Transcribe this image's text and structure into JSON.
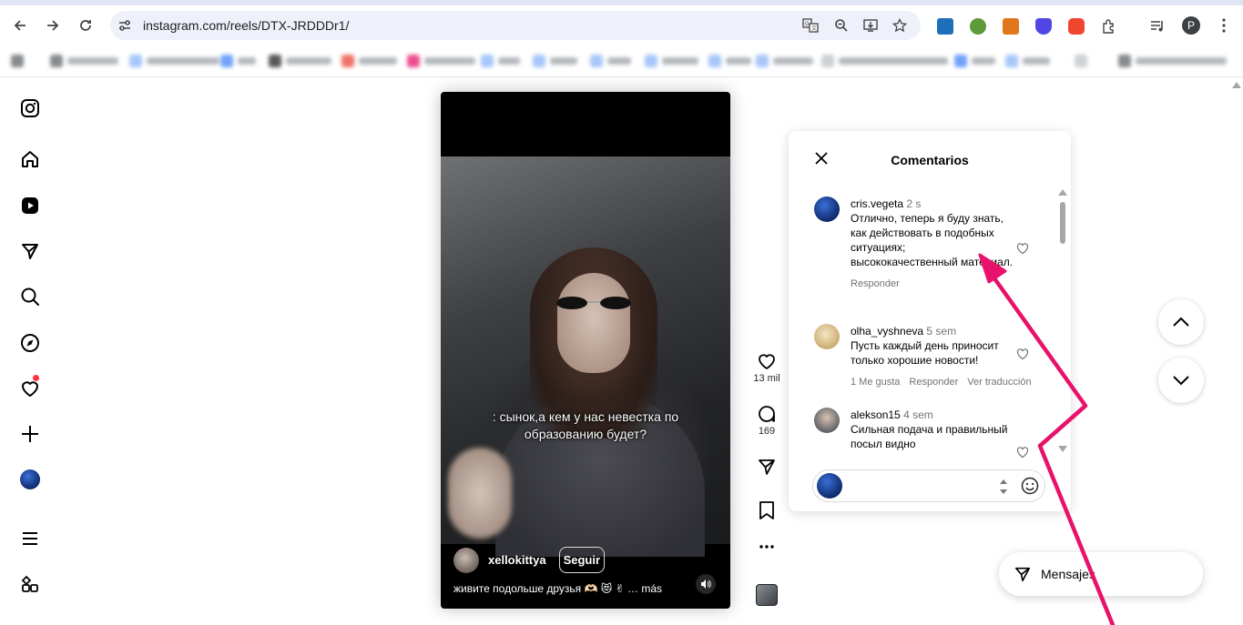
{
  "browser": {
    "url": "instagram.com/reels/DTX-JRDDDr1/",
    "profile_initial": "P"
  },
  "reel": {
    "overlay_text": ": сынок,а кем у нас невестка по образованию будет?",
    "owner": "xellokittya",
    "follow_label": "Seguir",
    "description": "живите подольше друзья 🫶🏻 😻 ✌ … más"
  },
  "actions": {
    "likes": "13 mil",
    "comments": "169"
  },
  "comments_panel": {
    "title": "Comentarios",
    "items": [
      {
        "user": "cris.vegeta",
        "time": "2 s",
        "text": "Отлично, теперь я буду знать, как действовать в подобных ситуациях; высококачественный материал.",
        "meta": [
          "Responder"
        ],
        "avatar_color": "#1f4fb8"
      },
      {
        "user": "olha_vyshneva",
        "time": "5 sem",
        "text": "Пусть каждый день приносит только хорошие новости!",
        "meta": [
          "1 Me gusta",
          "Responder",
          "Ver traducción"
        ],
        "avatar_color": "#e8d7b0"
      },
      {
        "user": "alekson15",
        "time": "4 sem",
        "text": "Сильная подача и правильный посыл видно",
        "meta": [],
        "avatar_color": "#8c8f94"
      }
    ],
    "composer_placeholder": ""
  },
  "messages": {
    "label": "Mensajes"
  },
  "colors": {
    "accent_pink": "#e8116b",
    "notification_red": "#ff3040"
  }
}
